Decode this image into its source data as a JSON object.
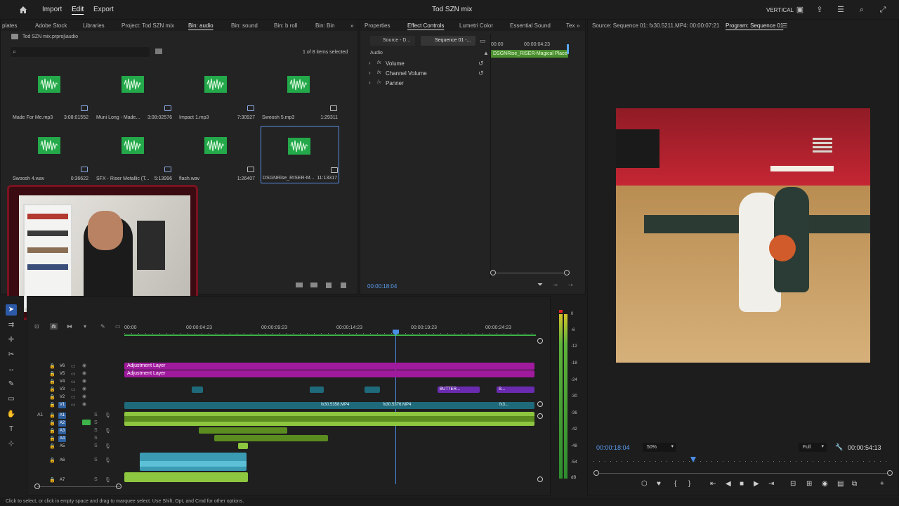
{
  "app": {
    "title": "Tod SZN mix",
    "menu": [
      "Import",
      "Edit",
      "Export"
    ],
    "active_menu": "Edit",
    "workspace": "VERTICAL"
  },
  "project": {
    "tabs": [
      "plates",
      "Adobe Stock",
      "Libraries",
      "Project: Tod SZN mix",
      "Bin: audio",
      "Bin: sound",
      "Bin: b roll",
      "Bin: Bin"
    ],
    "active_tab": "Bin: audio",
    "path": "Tod SZN mix.prproj\\audio",
    "selection": "1 of 8 items selected",
    "items": [
      {
        "name": "Made For Me.mp3",
        "dur": "3:08:01552"
      },
      {
        "name": "Muni Long - Made...",
        "dur": "3:08:02576"
      },
      {
        "name": "Impact 1.mp3",
        "dur": "7:30927"
      },
      {
        "name": "Swoosh 5.mp3",
        "dur": "1:29311"
      },
      {
        "name": "Swoosh 4.wav",
        "dur": "0:36622"
      },
      {
        "name": "SFX - Riser Metallic (T...",
        "dur": "5:13996"
      },
      {
        "name": "flash.wav",
        "dur": "1:26407"
      },
      {
        "name": "DSGNRise_RISER-M...",
        "dur": "11:13317"
      }
    ]
  },
  "effects": {
    "tabs": [
      "Properties",
      "Effect Controls",
      "Lumetri Color",
      "Essential Sound",
      "Tex"
    ],
    "active_tab": "Effect Controls",
    "source_tab": "Source - D...",
    "seq_tab": "Sequence 01 -...",
    "section": "Audio",
    "rows": [
      "Volume",
      "Channel Volume",
      "Panner"
    ],
    "mini_ruler": [
      "00:00",
      "00:00:04:23"
    ],
    "clip_name": "DSGNRise_RISER-Magical Place",
    "timecode": "00:00:18:04"
  },
  "program": {
    "source_tab": "Source: Sequence 01: fx30.5211.MP4: 00:00:07:21",
    "program_tab": "Program: Sequence 01",
    "timecode": "00:00:18:04",
    "zoom": "50%",
    "quality": "Full",
    "duration": "00:00:54:13"
  },
  "timeline": {
    "ruler": [
      "00:00",
      "00:00:04:23",
      "00:00:09:23",
      "00:00:14:23",
      "00:00:19:23",
      "00:00:24:23"
    ],
    "video_tracks": [
      "V6",
      "V5",
      "V4",
      "V3",
      "V2",
      "V1"
    ],
    "audio_tracks": [
      "A1",
      "A2",
      "A3",
      "A4",
      "A5",
      "A6",
      "A7"
    ],
    "src_patch_a": "A1",
    "adjustment": "Adjustment Layer",
    "clip_v1_a": "fx30.5358.MP4",
    "clip_v1_b": "fx30.5376.MP4",
    "clip_v1_c": "fx3...",
    "clip_v3_a": "BUTTER...",
    "clip_v3_b": "S..."
  },
  "meter": {
    "labels": [
      "0",
      "-6",
      "-12",
      "-18",
      "-24",
      "-30",
      "-36",
      "-42",
      "-48",
      "-54",
      "dB"
    ]
  },
  "status": {
    "text": "Click to select, or click in empty space and drag to marquee select. Use Shift, Opt, and Cmd for other options."
  },
  "colors": {
    "accent": "#2d8ceb",
    "audio_clip": "#8dc63f",
    "adjustment": "#a01a9e",
    "v1_clip": "#1f6a7a",
    "bin_thumb": "#23a84a"
  }
}
